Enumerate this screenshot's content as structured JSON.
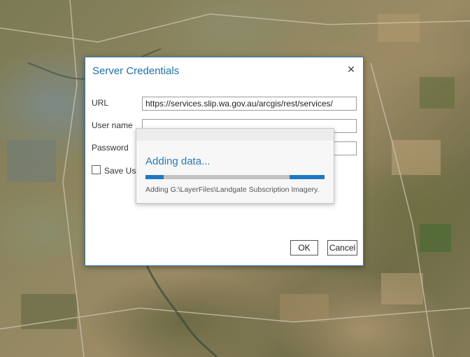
{
  "dialog": {
    "title": "Server Credentials",
    "close_label": "✕",
    "fields": {
      "url": {
        "label": "URL",
        "value": "https://services.slip.wa.gov.au/arcgis/rest/services/"
      },
      "username": {
        "label": "User name",
        "value": ""
      },
      "password": {
        "label": "Password",
        "value": ""
      }
    },
    "save_checkbox_label": "Save Use",
    "ok_label": "OK",
    "cancel_label": "Cancel"
  },
  "progress": {
    "title": "Adding data...",
    "message": "Adding G:\\LayerFiles\\Landgate Subscription Imagery.",
    "accent_color": "#1f78c1"
  }
}
